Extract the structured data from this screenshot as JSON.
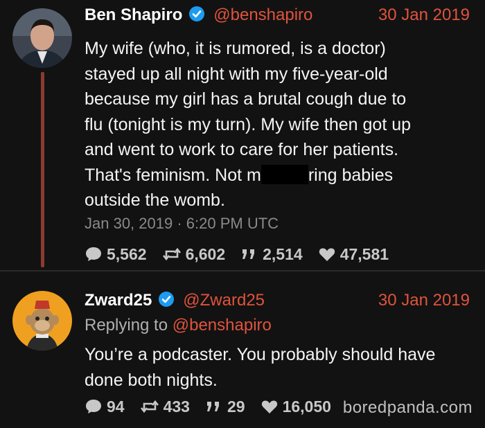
{
  "tweets": [
    {
      "name": "Ben Shapiro",
      "handle": "@benshapiro",
      "date": "30 Jan 2019",
      "body_lines": [
        "My wife (who, it is rumored, is a doctor)",
        "stayed up all night with my five-year-old",
        "because my girl has a brutal cough due to",
        "flu (tonight is my turn). My wife then got up",
        "and went to work to care for her patients.",
        "That's feminism. Not m",
        "ring babies",
        "outside the womb."
      ],
      "timestamp": "Jan 30, 2019 · 6:20 PM UTC",
      "stats": {
        "replies": "5,562",
        "retweets": "6,602",
        "quotes": "2,514",
        "likes": "47,581"
      }
    },
    {
      "name": "Zward25",
      "handle": "@Zward25",
      "date": "30 Jan 2019",
      "replying_prefix": "Replying to",
      "replying_to": "@benshapiro",
      "body_lines": [
        "You’re a podcaster. You probably should have",
        "done both nights."
      ],
      "stats": {
        "replies": "94",
        "retweets": "433",
        "quotes": "29",
        "likes": "16,050"
      }
    }
  ],
  "watermark": "boredpanda.com",
  "colors": {
    "accent": "#e0533d",
    "background": "#121212",
    "verified": "#1d9bf0",
    "thread_line": "#8a3a2e"
  }
}
